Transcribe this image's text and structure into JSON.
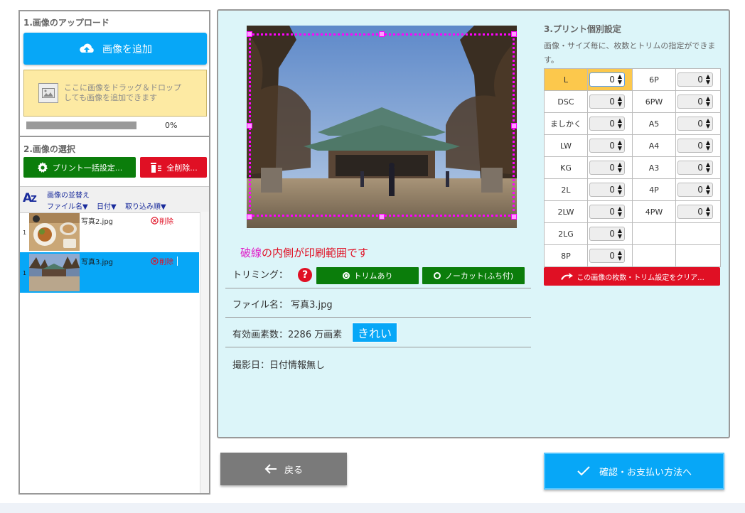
{
  "upload": {
    "title": "1.画像のアップロード",
    "add_label": "画像を追加",
    "drop_line1": "ここに画像をドラッグ＆ドロップ",
    "drop_line2": "しても画像を追加できます",
    "progress": "0%"
  },
  "select": {
    "title": "2.画像の選択",
    "print_settings_label": "プリント一括設定...",
    "delete_all_label": "全削除..."
  },
  "sort": {
    "label": "画像の並替え",
    "options": [
      "ファイル名▼",
      "日付▼",
      "取り込み順▼"
    ]
  },
  "files": [
    {
      "num": "1",
      "name": "写真2.jpg",
      "delete": "削除",
      "selected": false
    },
    {
      "num": "1",
      "name": "写真3.jpg",
      "delete": "削除",
      "selected": true
    }
  ],
  "preview": {
    "note_accent": "破線",
    "note_rest": "の内側が印刷範囲です",
    "trimming_label": "トリミング：",
    "trim_option": "トリムあり",
    "nocut_option": "ノーカット(ふち付)",
    "filename_label": "ファイル名：",
    "filename_value": "写真3.jpg",
    "pixels_label": "有効画素数：",
    "pixels_value": "2286 万画素",
    "quality": "きれい",
    "date_label": "撮影日：",
    "date_value": "日付情報無し"
  },
  "print": {
    "title": "3.プリント個別設定",
    "desc": "画像・サイズ毎に、枚数とトリムの指定ができます。",
    "rows": [
      {
        "left": "L",
        "left_val": "0",
        "right": "6P",
        "right_val": "0"
      },
      {
        "left": "DSC",
        "left_val": "0",
        "right": "6PW",
        "right_val": "0"
      },
      {
        "left": "ましかく",
        "left_val": "0",
        "right": "A5",
        "right_val": "0"
      },
      {
        "left": "LW",
        "left_val": "0",
        "right": "A4",
        "right_val": "0"
      },
      {
        "left": "KG",
        "left_val": "0",
        "right": "A3",
        "right_val": "0"
      },
      {
        "left": "2L",
        "left_val": "0",
        "right": "4P",
        "right_val": "0"
      },
      {
        "left": "2LW",
        "left_val": "0",
        "right": "4PW",
        "right_val": "0"
      },
      {
        "left": "2LG",
        "left_val": "0",
        "right": "",
        "right_val": ""
      },
      {
        "left": "8P",
        "left_val": "0",
        "right": "",
        "right_val": ""
      }
    ],
    "clear_label": "この画像の枚数・トリム設定をクリア..."
  },
  "nav": {
    "back_label": "戻る",
    "confirm_label": "確認・お支払い方法へ"
  },
  "colors": {
    "accent": "#07a7f7",
    "green": "#0b7d0b",
    "red": "#e01024",
    "trim": "#ff00ff",
    "active_cell": "#fcc84c"
  }
}
